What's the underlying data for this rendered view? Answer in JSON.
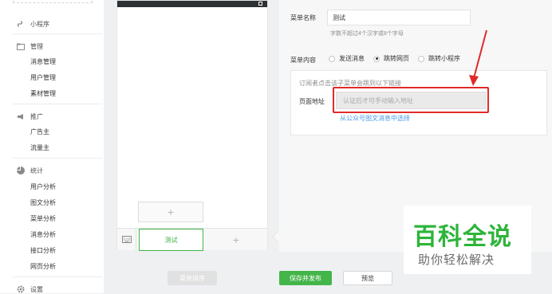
{
  "sidebar": {
    "mini_program": "小程序",
    "manage": {
      "title": "管理",
      "items": [
        "消息管理",
        "用户管理",
        "素材管理"
      ]
    },
    "promote": {
      "title": "推广",
      "items": [
        "广告主",
        "流量主"
      ]
    },
    "stats": {
      "title": "统计",
      "items": [
        "用户分析",
        "图文分析",
        "菜单分析",
        "消息分析",
        "接口分析",
        "网页分析"
      ]
    },
    "settings": "设置"
  },
  "preview": {
    "add_sub_symbol": "+",
    "active_menu": "测试",
    "add_menu_symbol": "+",
    "sort_button": "菜单排序"
  },
  "editor": {
    "name_label": "菜单名称",
    "name_value": "测试",
    "name_hint": "字数不超过4个汉字或8个字母",
    "content_label": "菜单内容",
    "options": [
      "发送消息",
      "跳转网页",
      "跳转小程序"
    ],
    "selected_option": "跳转网页",
    "url_desc": "订阅者点击该子菜单会跳到以下链接",
    "url_label": "页面地址",
    "url_placeholder": "认证后才可手动输入地址",
    "url_link": "从公众号图文消息中选择"
  },
  "actions": {
    "save_publish": "保存并发布",
    "preview": "预览"
  },
  "watermark": {
    "title": "百科全说",
    "subtitle": "助你轻松解决"
  },
  "colors": {
    "accent_green": "#44b549",
    "highlight_red": "#e02a2a",
    "link_blue": "#459ae9"
  }
}
